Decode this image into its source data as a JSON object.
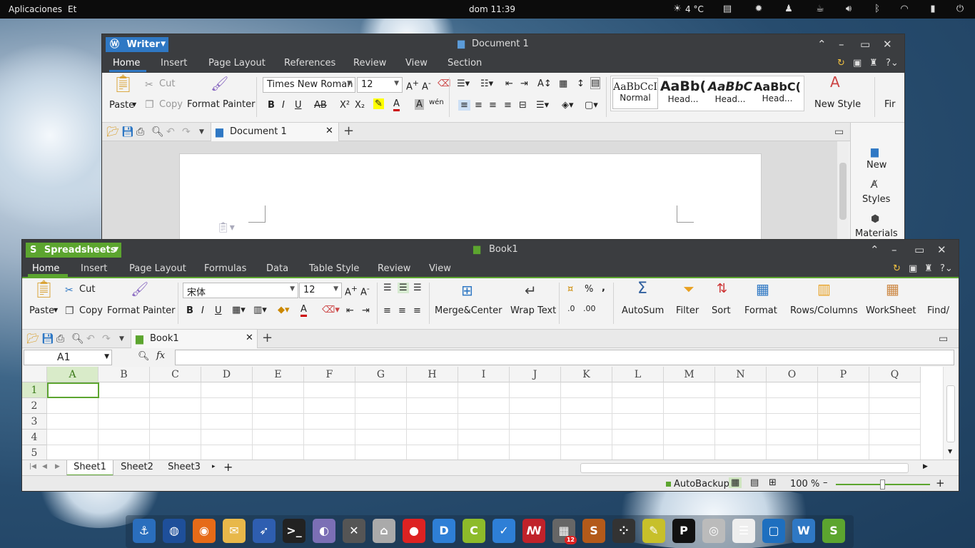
{
  "topbar": {
    "apps": "Aplicaciones",
    "places": "Et",
    "clock": "dom 11:39",
    "weather": "4 °C"
  },
  "writer": {
    "app_button": "Writer",
    "title": "Document 1",
    "menu": [
      "Home",
      "Insert",
      "Page Layout",
      "References",
      "Review",
      "View",
      "Section"
    ],
    "ribbon": {
      "cut": "Cut",
      "copy": "Copy",
      "paste": "Paste",
      "format_painter": "Format Painter",
      "font": "Times New Roman",
      "size": "12",
      "styles": [
        {
          "preview": "AaBbCcI",
          "label": "Normal"
        },
        {
          "preview": "AaBb(",
          "label": "Head..."
        },
        {
          "preview": "AaBbC",
          "label": "Head..."
        },
        {
          "preview": "AaBbC(",
          "label": "Head..."
        }
      ],
      "new_style": "New Style",
      "find": "Fir"
    },
    "doc_tab": "Document 1",
    "side_panel": [
      {
        "icon": "new-icon",
        "label": "New"
      },
      {
        "icon": "styles-icon",
        "label": "Styles"
      },
      {
        "icon": "materials-icon",
        "label": "Materials"
      }
    ]
  },
  "sheets": {
    "app_button": "Spreadsheets",
    "title": "Book1",
    "menu": [
      "Home",
      "Insert",
      "Page Layout",
      "Formulas",
      "Data",
      "Table Style",
      "Review",
      "View"
    ],
    "ribbon": {
      "cut": "Cut",
      "copy": "Copy",
      "paste": "Paste",
      "format_painter": "Format Painter",
      "font": "宋体",
      "size": "12",
      "merge": "Merge&Center",
      "wrap": "Wrap Text",
      "percent": "%",
      "comma": ",",
      "autosum": "AutoSum",
      "filter": "Filter",
      "sort": "Sort",
      "format": "Format",
      "rowscols": "Rows/Columns",
      "worksheet": "WorkSheet",
      "find": "Find/"
    },
    "doc_tab": "Book1",
    "namebox": "A1",
    "fx": "fx",
    "columns": [
      "A",
      "B",
      "C",
      "D",
      "E",
      "F",
      "G",
      "H",
      "I",
      "J",
      "K",
      "L",
      "M",
      "N",
      "O",
      "P",
      "Q"
    ],
    "rows": [
      "1",
      "2",
      "3",
      "4",
      "5"
    ],
    "sheet_tabs": [
      "Sheet1",
      "Sheet2",
      "Sheet3"
    ],
    "status": {
      "autobackup": "AutoBackup",
      "zoom": "100 %"
    }
  },
  "colors": {
    "accent_green": "#5ca52f",
    "writer_blue": "#2f78c4",
    "titlebar": "#3b3d40"
  },
  "dock": [
    {
      "icon": "anchor-icon"
    },
    {
      "icon": "globe-icon"
    },
    {
      "icon": "firefox-icon"
    },
    {
      "icon": "mail-icon"
    },
    {
      "icon": "compass-icon"
    },
    {
      "icon": "terminal-icon"
    },
    {
      "icon": "toggle-icon"
    },
    {
      "icon": "tools-icon"
    },
    {
      "icon": "home-folder-icon"
    },
    {
      "icon": "tomato-icon"
    },
    {
      "icon": "d-icon"
    },
    {
      "icon": "c-icon"
    },
    {
      "icon": "check-icon"
    },
    {
      "icon": "mendeley-icon"
    },
    {
      "icon": "grid-icon",
      "badge": "12"
    },
    {
      "icon": "s-icon"
    },
    {
      "icon": "apps-icon"
    },
    {
      "icon": "note-icon"
    },
    {
      "icon": "p-icon"
    },
    {
      "icon": "disk-icon"
    },
    {
      "icon": "list-icon"
    },
    {
      "icon": "window-icon"
    },
    {
      "icon": "w-icon"
    },
    {
      "icon": "spreadsheet-icon"
    }
  ]
}
